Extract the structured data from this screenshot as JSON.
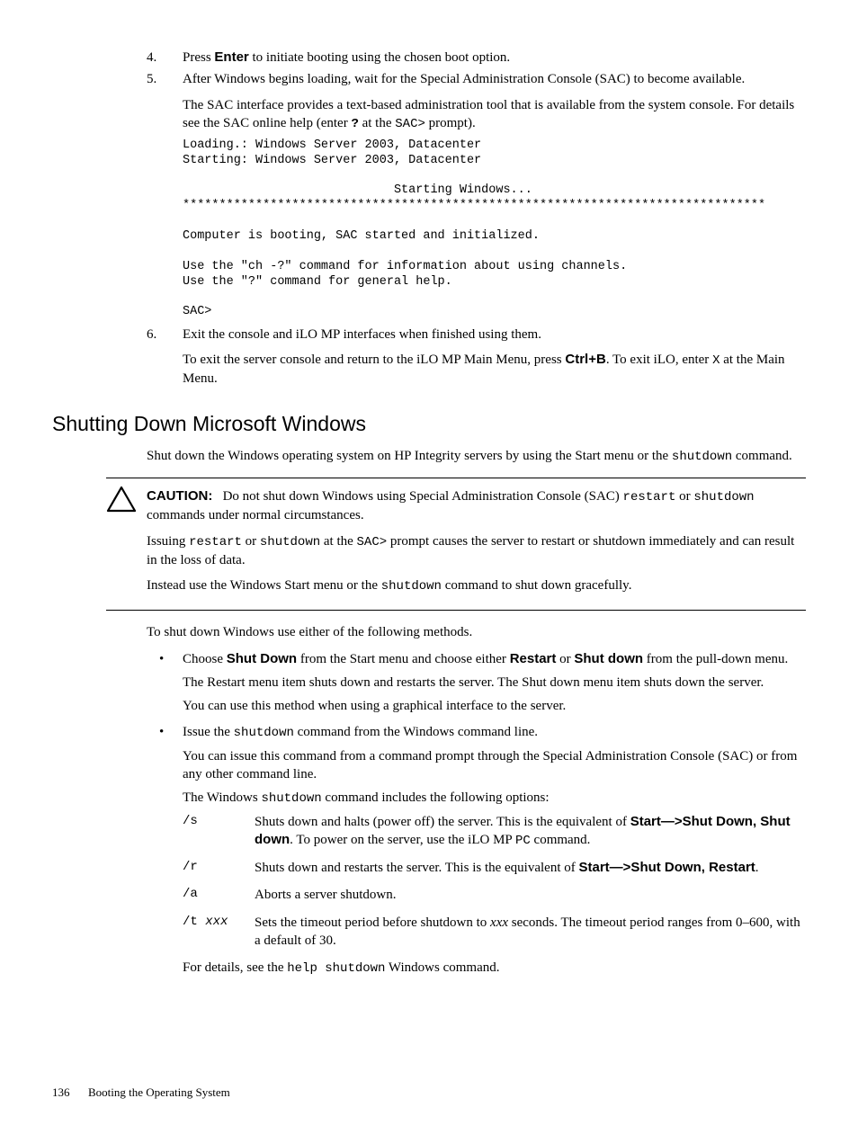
{
  "steps": {
    "s4": {
      "num": "4.",
      "text_a": "Press ",
      "bold": "Enter",
      "text_b": " to initiate booting using the chosen boot option."
    },
    "s5": {
      "num": "5.",
      "line1": "After Windows begins loading, wait for the Special Administration Console (SAC) to become available.",
      "line2_a": "The SAC interface provides a text-based administration tool that is available from the system console. For details see the SAC online help (enter ",
      "line2_q": "?",
      "line2_b": " at the ",
      "line2_sac": "SAC>",
      "line2_c": " prompt).",
      "code": "Loading.: Windows Server 2003, Datacenter\nStarting: Windows Server 2003, Datacenter\n\n                             Starting Windows...\n********************************************************************************\n\nComputer is booting, SAC started and initialized.\n\nUse the \"ch -?\" command for information about using channels.\nUse the \"?\" command for general help.\n\nSAC>"
    },
    "s6": {
      "num": "6.",
      "line1": "Exit the console and iLO MP interfaces when finished using them.",
      "line2_a": "To exit the server console and return to the iLO MP Main Menu, press ",
      "line2_bold": "Ctrl+B",
      "line2_b": ". To exit iLO, enter ",
      "line2_x": "X",
      "line2_c": " at the Main Menu."
    }
  },
  "section": {
    "title": "Shutting Down Microsoft Windows"
  },
  "intro": {
    "a": "Shut down the Windows operating system on HP Integrity servers by using the Start menu or the ",
    "cmd": "shutdown",
    "b": " command."
  },
  "caution": {
    "label": "CAUTION:",
    "p1_a": "Do not shut down Windows using Special Administration Console (SAC) ",
    "p1_restart": "restart",
    "p1_b": " or ",
    "p1_shutdown": "shutdown",
    "p1_c": " commands under normal circumstances.",
    "p2_a": "Issuing ",
    "p2_restart": "restart",
    "p2_b": " or ",
    "p2_shutdown": "shutdown",
    "p2_c": " at the ",
    "p2_sac": "SAC>",
    "p2_d": " prompt causes the server to restart or shutdown immediately and can result in the loss of data.",
    "p3_a": "Instead use the Windows Start menu or the ",
    "p3_cmd": "shutdown",
    "p3_b": " command to shut down gracefully."
  },
  "methods_intro": "To shut down Windows use either of the following methods.",
  "bullet1": {
    "a": "Choose ",
    "b1": "Shut Down",
    "b": " from the Start menu and choose either ",
    "b2": "Restart",
    "c": " or ",
    "b3": "Shut down",
    "d": " from the pull-down menu.",
    "p2": "The Restart menu item shuts down and restarts the server. The Shut down menu item shuts down the server.",
    "p3": "You can use this method when using a graphical interface to the server."
  },
  "bullet2": {
    "a": "Issue the ",
    "cmd": "shutdown",
    "b": " command from the Windows command line.",
    "p2": "You can issue this command from a command prompt through the Special Administration Console (SAC) or from any other command line.",
    "p3_a": "The Windows ",
    "p3_cmd": "shutdown",
    "p3_b": " command includes the following options:",
    "opts": {
      "s": {
        "key": "/s",
        "d_a": "Shuts down and halts (power off) the server. This is the equivalent of ",
        "d_bold": "Start—>Shut Down, Shut down",
        "d_b": ". To power on the server, use the iLO MP ",
        "d_pc": "PC",
        "d_c": " command."
      },
      "r": {
        "key": "/r",
        "d_a": "Shuts down and restarts the server. This is the equivalent of ",
        "d_bold": "Start—>Shut Down, Restart",
        "d_b": "."
      },
      "a": {
        "key": "/a",
        "d": "Aborts a server shutdown."
      },
      "t": {
        "key_a": "/t ",
        "key_i": "xxx",
        "d_a": "Sets the timeout period before shutdown to ",
        "d_i": "xxx",
        "d_b": " seconds. The timeout period ranges from 0–600, with a default of 30."
      }
    },
    "p4_a": "For details, see the ",
    "p4_cmd": "help shutdown",
    "p4_b": " Windows command."
  },
  "footer": {
    "page": "136",
    "title": "Booting the Operating System"
  }
}
